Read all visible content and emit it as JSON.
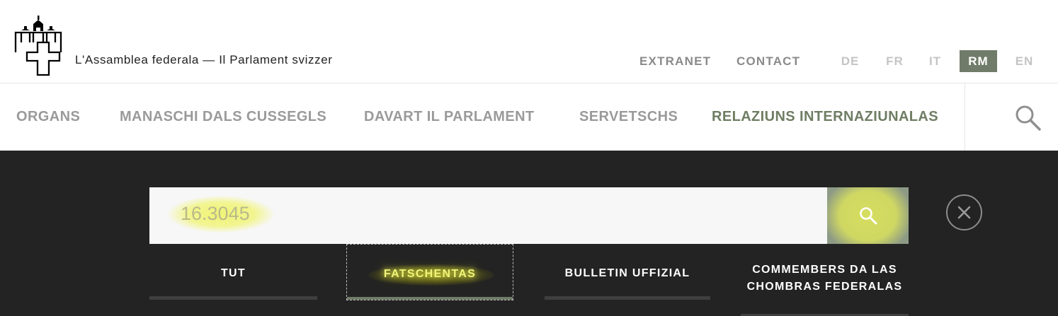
{
  "header": {
    "site_title": "L'Assamblea federala — Il Parlament svizzer",
    "service_links": [
      "EXTRANET",
      "CONTACT"
    ],
    "languages": [
      {
        "code": "DE",
        "active": false
      },
      {
        "code": "FR",
        "active": false
      },
      {
        "code": "IT",
        "active": false
      },
      {
        "code": "RM",
        "active": true
      },
      {
        "code": "EN",
        "active": false
      }
    ]
  },
  "nav": {
    "items": [
      {
        "label": "ORGANS",
        "current": false
      },
      {
        "label": "MANASCHI DALS CUSSEGLS",
        "current": false
      },
      {
        "label": "DAVART IL PARLAMENT",
        "current": false
      },
      {
        "label": "SERVETSCHS",
        "current": false
      },
      {
        "label": "RELAZIUNS INTERNAZIUNALAS",
        "current": true
      }
    ],
    "search_icon": "search-icon"
  },
  "search": {
    "value": "16.3045",
    "submit_icon": "search-icon",
    "close_icon": "close-icon",
    "tabs": [
      {
        "label": "TUT",
        "active": false
      },
      {
        "label": "FATSCHENTAS",
        "active": true
      },
      {
        "label": "BULLETIN UFFIZIAL",
        "active": false
      },
      {
        "label": "COMMEMBERS DA LAS CHOMBRAS FEDERALAS",
        "active": false
      }
    ]
  },
  "colors": {
    "accent": "#707c69",
    "overlay_bg": "#232323",
    "highlight": "#f0f46e"
  }
}
